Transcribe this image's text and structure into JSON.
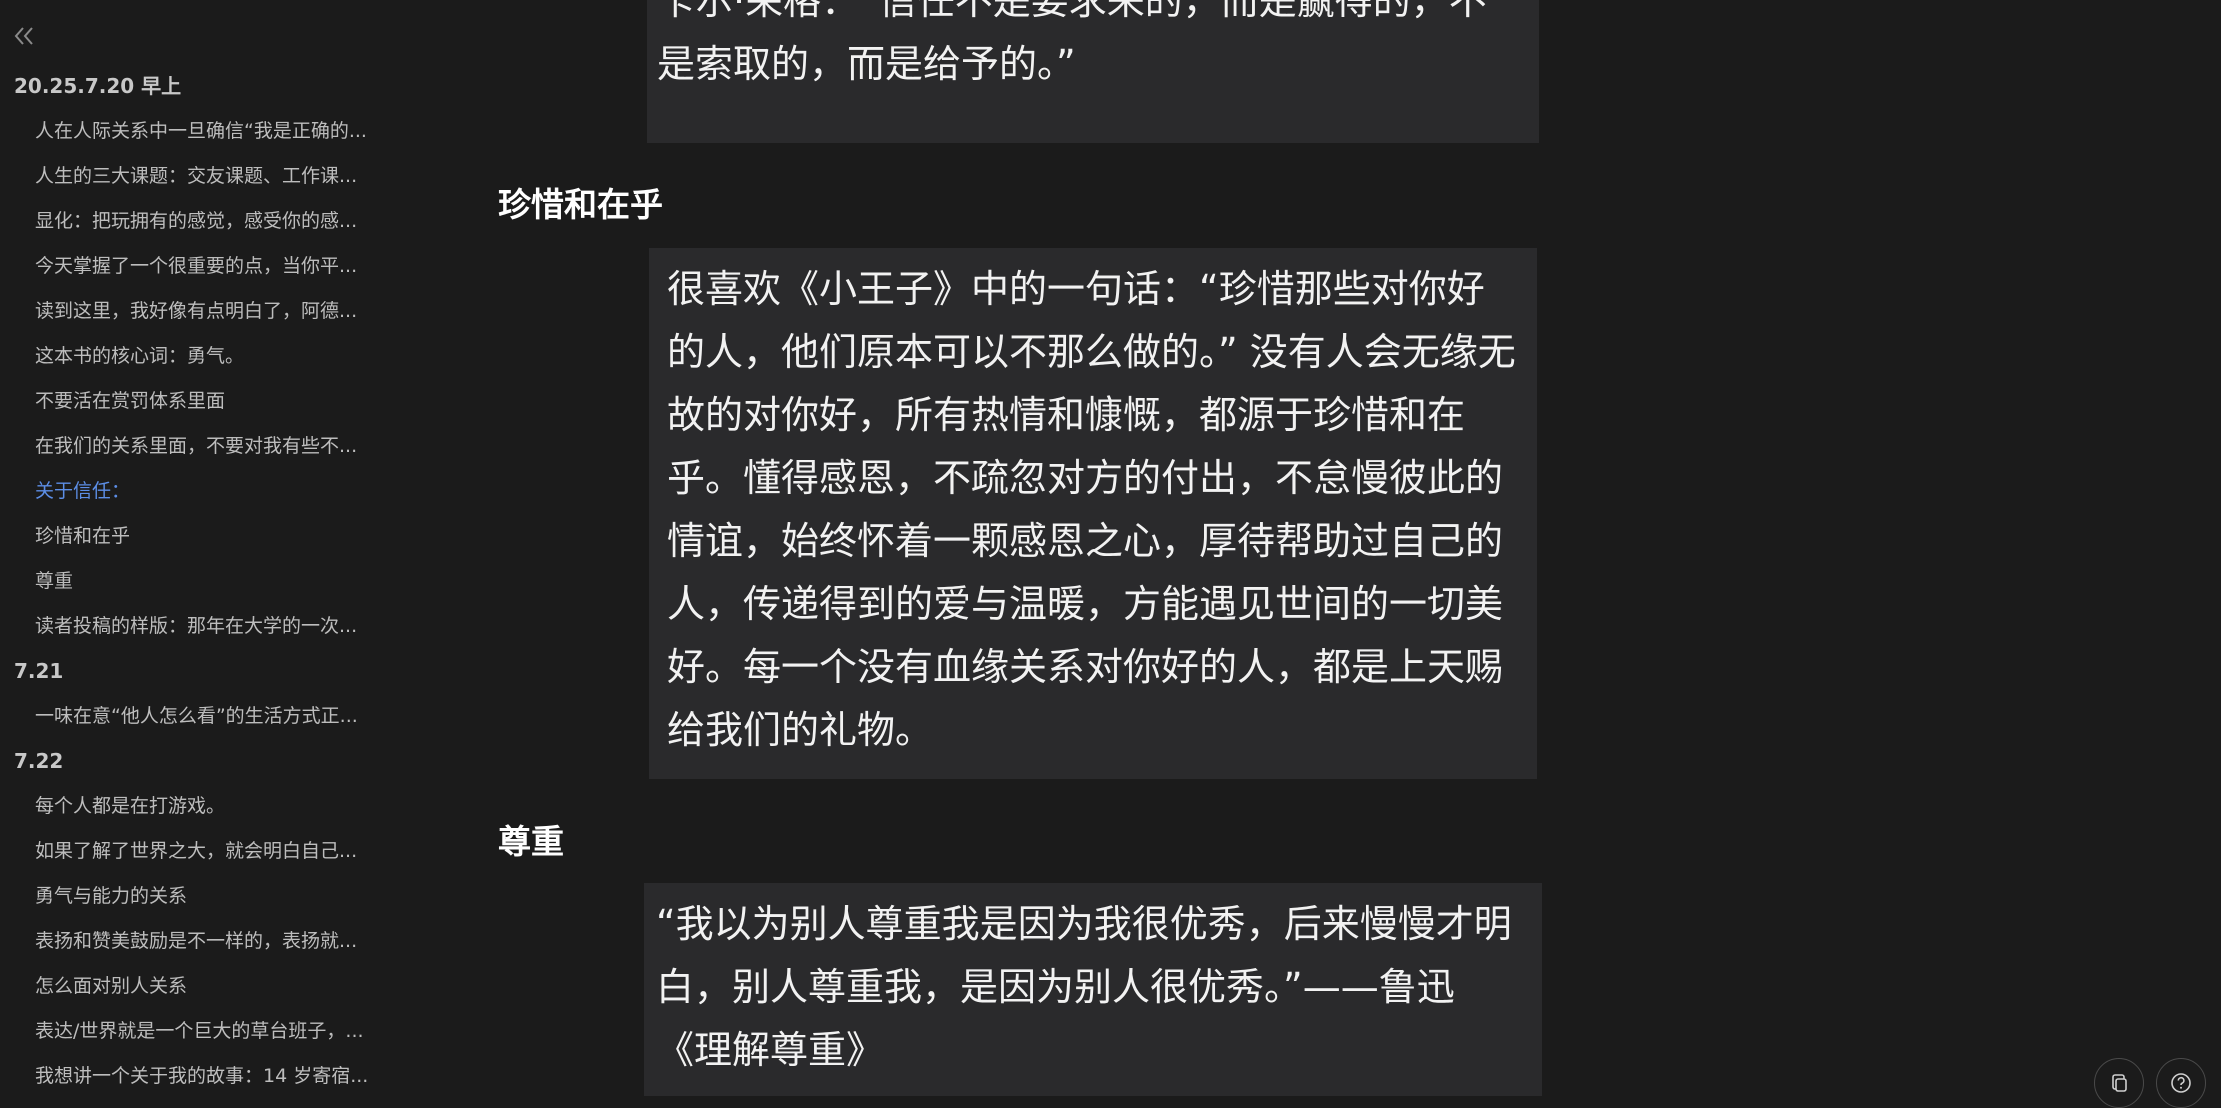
{
  "sidebar": {
    "collapse_icon": "double-chevron-left-icon",
    "items": [
      {
        "level": 1,
        "label": "20.25.7.20 早上"
      },
      {
        "level": 2,
        "label": "人在人际关系中一旦确信“我是正确的..."
      },
      {
        "level": 2,
        "label": "人生的三大课题：交友课题、工作课..."
      },
      {
        "level": 2,
        "label": "显化：把玩拥有的感觉，感受你的感..."
      },
      {
        "level": 2,
        "label": "今天掌握了一个很重要的点，当你平..."
      },
      {
        "level": 2,
        "label": "读到这里，我好像有点明白了，阿德..."
      },
      {
        "level": 2,
        "label": "这本书的核心词：勇气。"
      },
      {
        "level": 2,
        "label": "不要活在赏罚体系里面"
      },
      {
        "level": 2,
        "label": "在我们的关系里面，不要对我有些不..."
      },
      {
        "level": 2,
        "label": "关于信任：",
        "active": true
      },
      {
        "level": 2,
        "label": "珍惜和在乎"
      },
      {
        "level": 2,
        "label": "尊重"
      },
      {
        "level": 2,
        "label": "读者投稿的样版：那年在大学的一次..."
      },
      {
        "level": 1,
        "label": "7.21"
      },
      {
        "level": 2,
        "label": "一味在意“他人怎么看”的生活方式正..."
      },
      {
        "level": 1,
        "label": "7.22"
      },
      {
        "level": 2,
        "label": "每个人都是在打游戏。"
      },
      {
        "level": 2,
        "label": "如果了解了世界之大，就会明白自己..."
      },
      {
        "level": 2,
        "label": "勇气与能力的关系"
      },
      {
        "level": 2,
        "label": "表扬和赞美鼓励是不一样的，表扬就..."
      },
      {
        "level": 2,
        "label": "怎么面对别人关系"
      },
      {
        "level": 2,
        "label": "表达/世界就是一个巨大的草台班子，..."
      },
      {
        "level": 2,
        "label": "我想讲一个关于我的故事：14 岁寄宿..."
      }
    ]
  },
  "content": {
    "trust_quote_lines": [
      "卡尔·荣格：“信任不是要求来的，而是赢得的，不",
      "是索取的，而是给予的。”"
    ],
    "cherish_heading": "珍惜和在乎",
    "cherish_quote": "很喜欢《小王子》中的一句话：“珍惜那些对你好的人，他们原本可以不那么做的。” 没有人会无缘无故的对你好，所有热情和慷慨，都源于珍惜和在乎。懂得感恩，不疏忽对方的付出，不怠慢彼此的情谊，始终怀着一颗感恩之心，厚待帮助过自己的人，传递得到的爱与温暖，方能遇见世间的一切美好。每一个没有血缘关系对你好的人，都是上天赐给我们的礼物。",
    "respect_heading": "尊重",
    "respect_quote": "“我以为别人尊重我是因为我很优秀，后来慢慢才明白，别人尊重我，是因为别人很优秀。”——鲁迅《理解尊重》"
  },
  "floating_buttons": {
    "copy_icon": "copy-icon",
    "help_icon": "help-icon"
  }
}
